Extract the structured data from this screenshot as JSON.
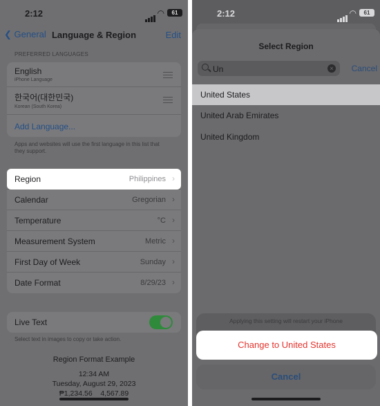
{
  "left": {
    "status": {
      "time": "2:12",
      "battery": "61"
    },
    "nav": {
      "back_label": "General",
      "title": "Language & Region",
      "edit_label": "Edit"
    },
    "preferred_header": "PREFERRED LANGUAGES",
    "languages": [
      {
        "name": "English",
        "sub": "iPhone Language"
      },
      {
        "name": "한국어(대한민국)",
        "sub": "Korean (South Korea)"
      }
    ],
    "add_language": "Add Language...",
    "footnote": "Apps and websites will use the first language in this list that they support.",
    "settings": [
      {
        "label": "Region",
        "value": "Philippines"
      },
      {
        "label": "Calendar",
        "value": "Gregorian"
      },
      {
        "label": "Temperature",
        "value": "°C"
      },
      {
        "label": "Measurement System",
        "value": "Metric"
      },
      {
        "label": "First Day of Week",
        "value": "Sunday"
      },
      {
        "label": "Date Format",
        "value": "8/29/23"
      }
    ],
    "live_text": {
      "label": "Live Text",
      "on": true,
      "note": "Select text in images to copy or take action."
    },
    "example": {
      "title": "Region Format Example",
      "time": "12:34 AM",
      "date": "Tuesday, August 29, 2023",
      "numbers": "₱1,234.56    4,567.89"
    }
  },
  "right": {
    "status": {
      "time": "2:12",
      "battery": "61"
    },
    "sheet_title": "Select Region",
    "search": {
      "value": "Un",
      "cancel_label": "Cancel"
    },
    "results": [
      "United States",
      "United Arab Emirates",
      "United Kingdom"
    ],
    "action_sheet": {
      "message": "Applying this setting will restart your iPhone",
      "confirm_label": "Change to United States",
      "cancel_label": "Cancel"
    }
  },
  "colors": {
    "accent_blue": "#244f86",
    "destructive_red": "#e2332c",
    "toggle_green": "#2f8a3c"
  }
}
